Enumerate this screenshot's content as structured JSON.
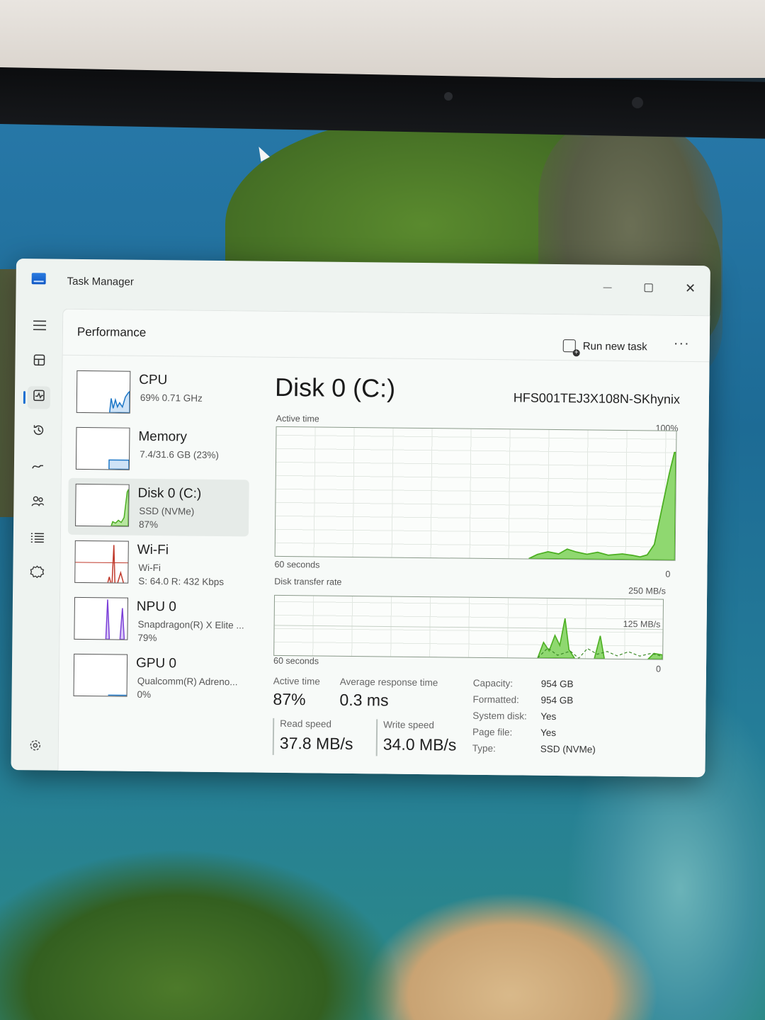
{
  "window": {
    "title": "Task Manager",
    "controls": {
      "minimize": "",
      "maximize": "",
      "close": "✕"
    }
  },
  "nav": [
    {
      "icon": "hamburger-menu-icon"
    },
    {
      "icon": "processes-icon"
    },
    {
      "icon": "performance-icon",
      "active": true
    },
    {
      "icon": "app-history-icon"
    },
    {
      "icon": "startup-apps-icon"
    },
    {
      "icon": "users-icon"
    },
    {
      "icon": "details-icon"
    },
    {
      "icon": "services-icon"
    }
  ],
  "header": {
    "title": "Performance",
    "run_new_task": "Run new task",
    "more": "···"
  },
  "resources": [
    {
      "name": "CPU",
      "sub1": "69% 0.71 GHz",
      "sub2": "",
      "graph_color": "#1e78c8",
      "level": 0.69
    },
    {
      "name": "Memory",
      "sub1": "7.4/31.6 GB (23%)",
      "sub2": "",
      "graph_color": "#1e78c8",
      "level": 0.23
    },
    {
      "name": "Disk 0 (C:)",
      "sub1": "SSD (NVMe)",
      "sub2": "87%",
      "graph_color": "#4caf22",
      "level": 0.87,
      "selected": true
    },
    {
      "name": "Wi-Fi",
      "sub1": "Wi-Fi",
      "sub2": "S: 64.0 R: 432 Kbps",
      "graph_color": "#c0392b"
    },
    {
      "name": "NPU 0",
      "sub1": "Snapdragon(R) X Elite ...",
      "sub2": "79%",
      "graph_color": "#7b3fd8",
      "level": 0.79
    },
    {
      "name": "GPU 0",
      "sub1": "Qualcomm(R) Adreno...",
      "sub2": "0%",
      "graph_color": "#1e78c8",
      "level": 0
    }
  ],
  "detail": {
    "title": "Disk 0 (C:)",
    "model": "HFS001TEJ3X108N-SKhynix",
    "active_time_graph": {
      "label": "Active time",
      "max": "100%",
      "duration": "60 seconds",
      "min": "0"
    },
    "transfer_graph": {
      "label": "Disk transfer rate",
      "max": "250 MB/s",
      "mid": "125 MB/s",
      "duration": "60 seconds",
      "min": "0"
    },
    "stats": {
      "active_time_label": "Active time",
      "active_time": "87%",
      "avg_response_label": "Average response time",
      "avg_response": "0.3 ms",
      "read_speed_label": "Read speed",
      "read_speed": "37.8 MB/s",
      "write_speed_label": "Write speed",
      "write_speed": "34.0 MB/s"
    },
    "properties": [
      {
        "label": "Capacity:",
        "value": "954 GB"
      },
      {
        "label": "Formatted:",
        "value": "954 GB"
      },
      {
        "label": "System disk:",
        "value": "Yes"
      },
      {
        "label": "Page file:",
        "value": "Yes"
      },
      {
        "label": "Type:",
        "value": "SSD (NVMe)"
      }
    ],
    "colors": {
      "disk_fill": "#8fd870",
      "disk_line": "#4caf22"
    }
  }
}
